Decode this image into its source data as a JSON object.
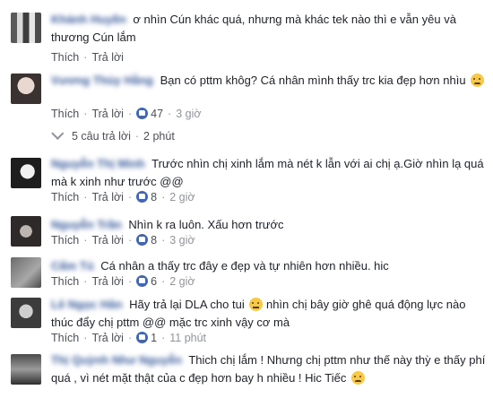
{
  "comments": [
    {
      "name": "Khánh Huyền",
      "text": "ơ nhìn Cún khác quá, nhưng mà khác tek nào thì e vẫn yêu và thương Cún lắm",
      "like_label": "Thích",
      "reply_label": "Trả lời",
      "avatar_colors": [
        "#5a5a5a",
        "#d9d9d9"
      ]
    },
    {
      "name": "Vương Thùy Hằng",
      "text": "Bạn có pttm khôg? Cá nhân mình thấy trc kia đẹp hơn nhìu",
      "emoji": "sad-face",
      "like_label": "Thích",
      "reply_label": "Trả lời",
      "like_count": "47",
      "time": "3 giờ",
      "avatar_colors": [
        "#3a3230",
        "#e9d8cf"
      ]
    },
    {
      "name": "Nguyễn Thị Minh",
      "text": "Trước nhìn chị xinh lắm mà nét k lẫn với ai chị ạ.Giờ nhìn lạ quá mà k xinh như trước @@",
      "like_label": "Thích",
      "reply_label": "Trả lời",
      "like_count": "8",
      "time": "2 giờ",
      "avatar_colors": [
        "#1e1e1e",
        "#f1f1f1"
      ]
    },
    {
      "name": "Nguyễn Trần",
      "text": "Nhìn k ra luôn. Xấu hơn trước",
      "like_label": "Thích",
      "reply_label": "Trả lời",
      "like_count": "8",
      "time": "3 giờ",
      "avatar_colors": [
        "#2e2a2a",
        "#bcb5b2"
      ]
    },
    {
      "name": "Cẩm Tú",
      "text": "Cá nhân a thấy trc đây e đẹp và tự nhiên hơn nhiều. hic",
      "like_label": "Thích",
      "reply_label": "Trả lời",
      "like_count": "6",
      "time": "2 giờ",
      "avatar_colors": [
        "#6b6b6b",
        "#a8a8a8"
      ]
    },
    {
      "name": "Lê Ngọc Hân",
      "text": "Hãy trả lại DLA cho tui",
      "text2": "nhìn chị bây giờ ghê quá động lực nào thúc đẩy chị pttm @@ mặc trc xinh vậy cơ mà",
      "emoji": "neutral-face",
      "like_label": "Thích",
      "reply_label": "Trả lời",
      "like_count": "1",
      "time": "11 phút",
      "avatar_colors": [
        "#3c3c3c",
        "#cfcfcf"
      ]
    },
    {
      "name": "Thị Quỳnh Như Nguyễn",
      "text": "Thich chị lắm ! Nhưng chị pttm như thế này thỳ e thấy phí quá , vì nét mặt thật của c đẹp hơn bay h nhiều ! Hic Tiếc",
      "emoji": "tear-face",
      "avatar_colors": [
        "#4a4a4a",
        "#9a9a9a"
      ]
    }
  ],
  "replies_link": {
    "label": "5 câu trả lời",
    "time": "2 phút"
  }
}
